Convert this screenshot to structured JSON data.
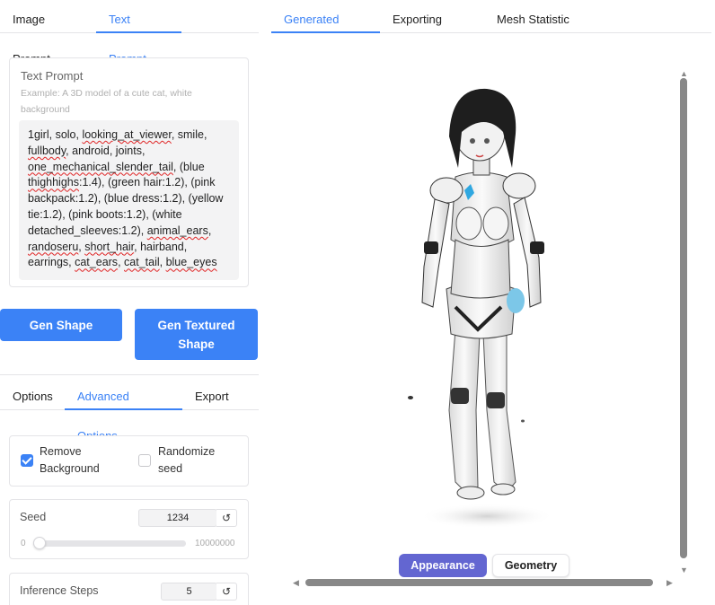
{
  "left_tabs": [
    {
      "label": "Image Prompt",
      "active": false
    },
    {
      "label": "Text Prompt",
      "active": true
    }
  ],
  "text_prompt": {
    "title": "Text Prompt",
    "placeholder": "Example: A 3D model of a cute cat, white background",
    "value_lines": [
      "1girl, solo, looking_at_viewer, smile,",
      "fullbody, android, joints,",
      "one_mechanical_slender_tail, (blue",
      "thighhighs:1.4), (green hair:1.2), (pink",
      "backpack:1.2), (blue dress:1.2), (yellow",
      "tie:1.2), (pink boots:1.2), (white",
      "detached_sleeves:1.2), animal_ears,",
      "randoseru, short_hair, hairband,",
      "earrings, cat_ears, cat_tail, blue_eyes"
    ]
  },
  "buttons": {
    "gen_shape": "Gen Shape",
    "gen_textured_shape": "Gen Textured Shape"
  },
  "option_tabs": [
    {
      "label": "Options",
      "active": false
    },
    {
      "label": "Advanced Options",
      "active": true
    },
    {
      "label": "Export",
      "active": false
    }
  ],
  "advanced": {
    "remove_background": {
      "label_line1": "Remove",
      "label_line2": "Background",
      "checked": true
    },
    "randomize_seed": {
      "label_line1": "Randomize",
      "label_line2": "seed",
      "checked": false
    },
    "seed": {
      "label": "Seed",
      "value": "1234",
      "min": "0",
      "max": "10000000",
      "fraction": 0.0001
    },
    "inference_steps": {
      "label": "Inference Steps",
      "value": "5"
    }
  },
  "right_tabs": [
    {
      "label": "Generated Mesh",
      "active": true
    },
    {
      "label": "Exporting Mesh",
      "active": false
    },
    {
      "label": "Mesh Statistic",
      "active": false
    }
  ],
  "viewer_toggle": {
    "appearance": "Appearance",
    "geometry": "Geometry",
    "active": "Appearance"
  },
  "icons": {
    "reset": "reset-icon",
    "scroll_up": "arrow-up-icon",
    "scroll_down": "arrow-down-icon",
    "scroll_left": "arrow-left-icon",
    "scroll_right": "arrow-right-icon"
  },
  "colors": {
    "accent": "#3b82f6",
    "toggle_active": "#6366d1"
  }
}
